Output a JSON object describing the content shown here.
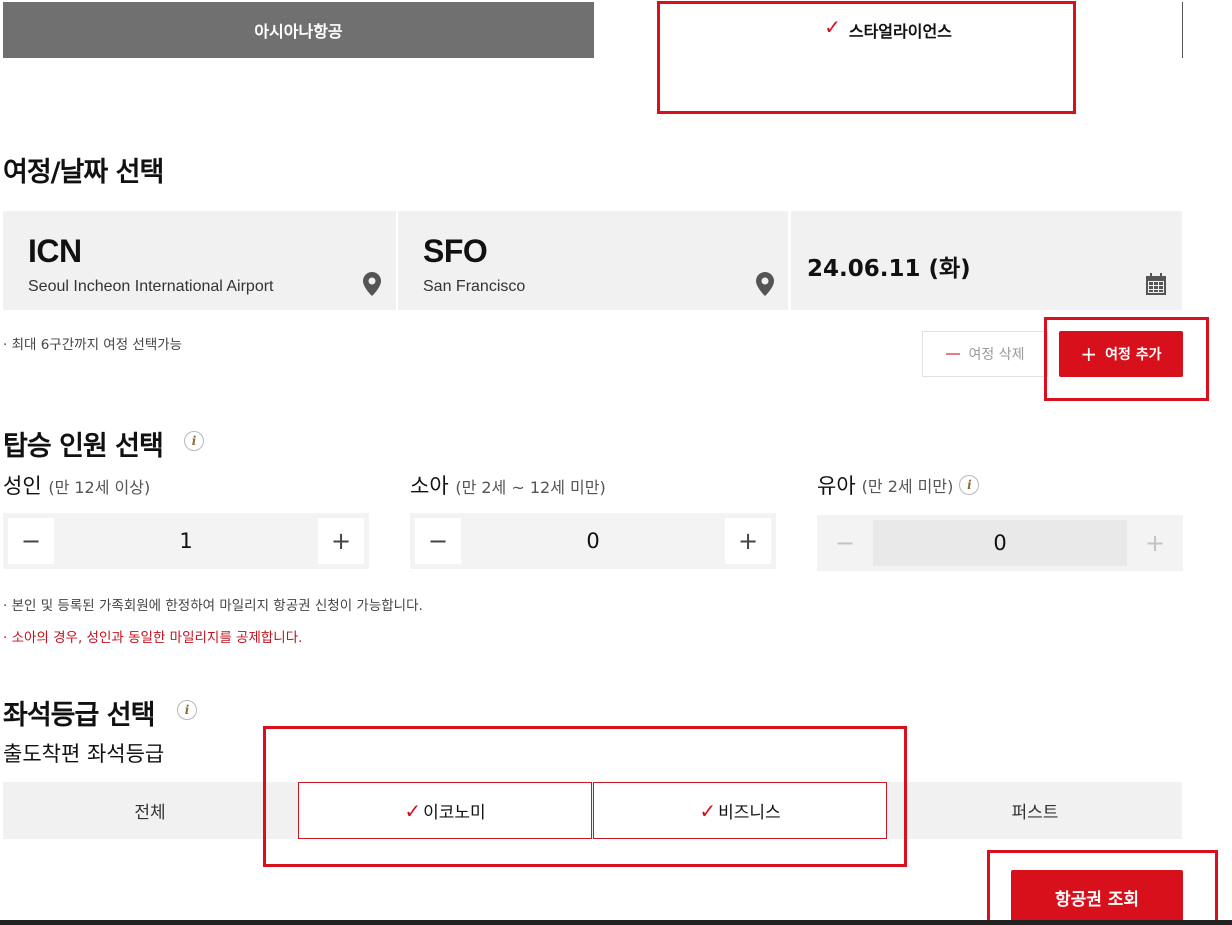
{
  "airline_tabs": {
    "asiana": "아시아나항공",
    "star_alliance": "스타얼라이언스",
    "check_icon": "check-icon"
  },
  "itinerary": {
    "title": "여정/날짜 선택",
    "origin": {
      "code": "ICN",
      "name": "Seoul Incheon International Airport"
    },
    "destination": {
      "code": "SFO",
      "name": "San Francisco"
    },
    "date": "24.06.11 (화)",
    "note": "· 최대 6구간까지 여정 선택가능",
    "delete_label": "여정 삭제",
    "add_label": "여정 추가"
  },
  "passengers": {
    "title": "탑승 인원 선택",
    "adult": {
      "label": "성인",
      "sub": "(만 12세 이상)",
      "value": "1"
    },
    "child": {
      "label": "소아",
      "sub": "(만 2세 ~ 12세 미만)",
      "value": "0"
    },
    "infant": {
      "label": "유아",
      "sub": "(만 2세 미만)",
      "value": "0"
    },
    "minus": "−",
    "plus": "+",
    "note1": "· 본인 및 등록된 가족회원에 한정하여 마일리지 항공권 신청이 가능합니다.",
    "note2": "· 소아의 경우, 성인과 동일한 마일리지를 공제합니다."
  },
  "cabin": {
    "title": "좌석등급 선택",
    "subtitle": "출도착편 좌석등급",
    "options": [
      {
        "label": "전체",
        "selected": false
      },
      {
        "label": "이코노미",
        "selected": true
      },
      {
        "label": "비즈니스",
        "selected": true
      },
      {
        "label": "퍼스트",
        "selected": false
      }
    ]
  },
  "search_button": "항공권 조회",
  "colors": {
    "accent": "#d8101c",
    "tab_gray": "#707070",
    "panel": "#f1f1f1"
  }
}
